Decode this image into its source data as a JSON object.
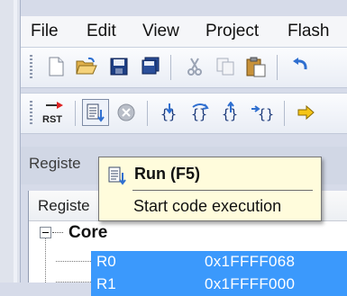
{
  "menu": {
    "items": [
      "File",
      "Edit",
      "View",
      "Project",
      "Flash"
    ]
  },
  "toolbar_file": {
    "icons": [
      "new-file-icon",
      "open-folder-icon",
      "save-icon",
      "save-all-icon",
      "cut-icon",
      "copy-icon",
      "paste-icon",
      "undo-icon"
    ]
  },
  "toolbar_debug": {
    "reset_label": "RST",
    "icons": [
      "reset-icon",
      "run-icon",
      "stop-icon",
      "step-icon",
      "step-over-icon",
      "step-out-icon",
      "run-to-cursor-icon",
      "show-next-statement-icon"
    ]
  },
  "registers_window": {
    "title": "Registe",
    "column_header": "Registe",
    "tree": {
      "group": "Core",
      "rows": [
        {
          "name": "R0",
          "value": "0x1FFFF068"
        },
        {
          "name": "R1",
          "value": "0x1FFFF000"
        }
      ]
    }
  },
  "tooltip": {
    "title": "Run (F5)",
    "description": "Start code execution"
  },
  "colors": {
    "selection": "#3b99fc",
    "tooltip_bg": "#fffcdc",
    "toolbar_bg": "#eef1f7"
  }
}
